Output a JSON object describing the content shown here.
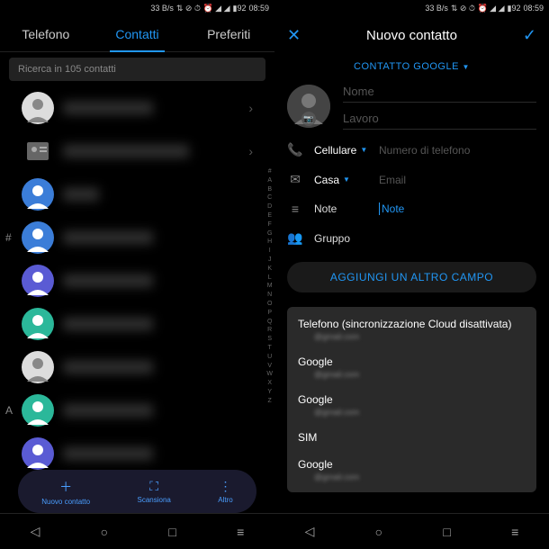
{
  "status": {
    "speed": "33 B/s",
    "icons": "⇅ ✕ 🕓 ⏰ 📶 📶",
    "battery": "92",
    "time": "08:59"
  },
  "left": {
    "tabs": {
      "t1": "Telefono",
      "t2": "Contatti",
      "t3": "Preferiti"
    },
    "search": "Ricerca in 105 contatti",
    "sections": {
      "hash": "#",
      "A": "A"
    },
    "alpha": [
      "#",
      "A",
      "B",
      "C",
      "D",
      "E",
      "F",
      "G",
      "H",
      "I",
      "J",
      "K",
      "L",
      "M",
      "N",
      "O",
      "P",
      "Q",
      "R",
      "S",
      "T",
      "U",
      "V",
      "W",
      "X",
      "Y",
      "Z"
    ],
    "toolbar": {
      "new": "Nuovo contatto",
      "scan": "Scansiona",
      "more": "Altro"
    }
  },
  "right": {
    "title": "Nuovo contatto",
    "accountType": "CONTATTO GOOGLE",
    "fields": {
      "name": "Nome",
      "work": "Lavoro",
      "phoneType": "Cellulare",
      "phonePh": "Numero di telefono",
      "emailType": "Casa",
      "emailPh": "Email",
      "noteLabel": "Note",
      "notePh": "Note",
      "group": "Gruppo"
    },
    "addField": "AGGIUNGI UN ALTRO CAMPO",
    "accounts": [
      {
        "name": "Telefono (sincronizzazione Cloud disattivata)",
        "email": "@gmail.com"
      },
      {
        "name": "Google",
        "email": "@gmail.com"
      },
      {
        "name": "Google",
        "email": "@gmail.com"
      },
      {
        "name": "SIM",
        "email": ""
      },
      {
        "name": "Google",
        "email": "@gmail.com"
      }
    ]
  }
}
